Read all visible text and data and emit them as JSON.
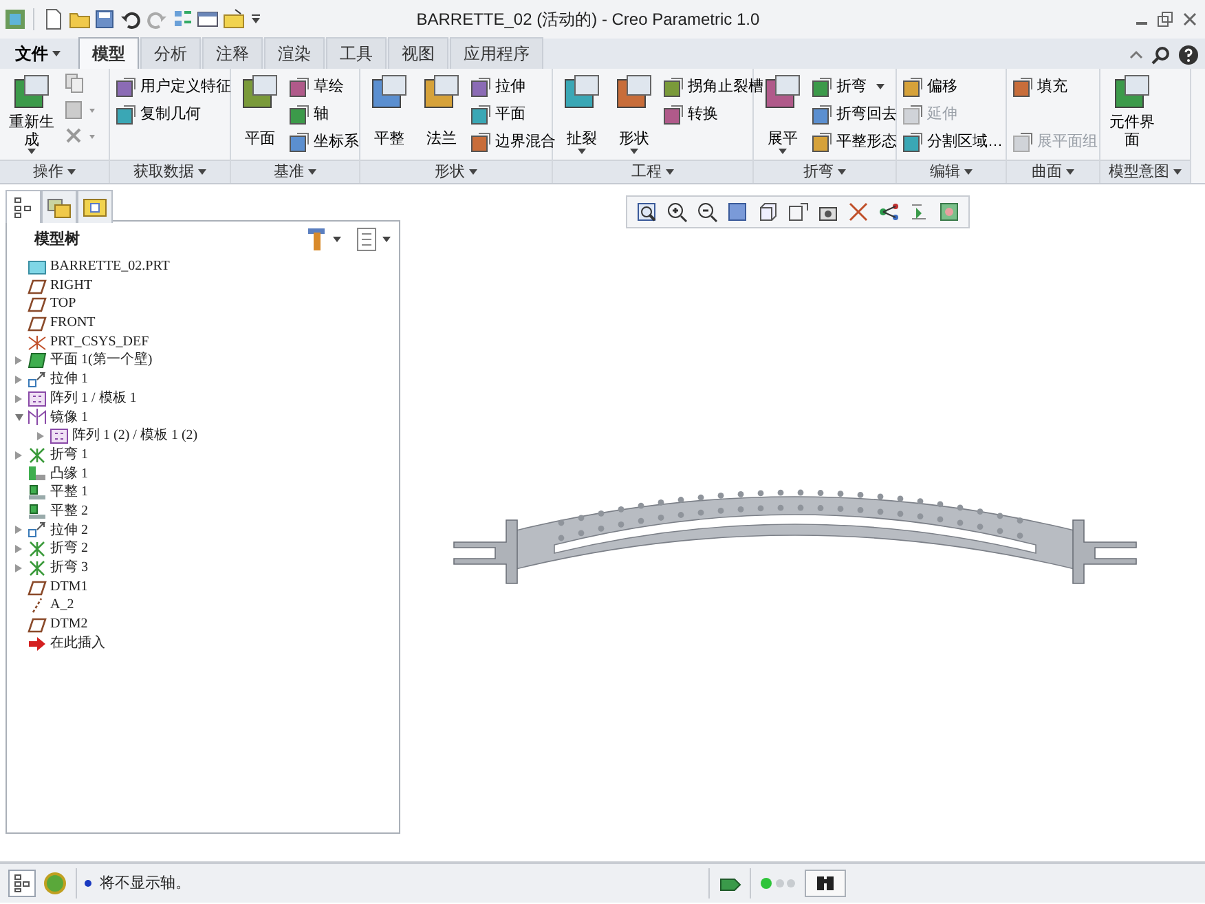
{
  "window": {
    "title": "BARRETTE_02 (活动的) - Creo Parametric 1.0"
  },
  "file_menu": {
    "label": "文件"
  },
  "tabs": [
    {
      "label": "模型",
      "selected": true
    },
    {
      "label": "分析",
      "selected": false
    },
    {
      "label": "注释",
      "selected": false
    },
    {
      "label": "渲染",
      "selected": false
    },
    {
      "label": "工具",
      "selected": false
    },
    {
      "label": "视图",
      "selected": false
    },
    {
      "label": "应用程序",
      "selected": false
    }
  ],
  "ribbon_groups": [
    {
      "label": "操作",
      "items": [
        {
          "kind": "large",
          "label": "重新生成",
          "dropdown": true
        },
        {
          "kind": "icon_stack"
        }
      ]
    },
    {
      "label": "获取数据",
      "items": [
        {
          "kind": "small",
          "label": "用户定义特征"
        },
        {
          "kind": "small",
          "label": "复制几何"
        }
      ]
    },
    {
      "label": "基准",
      "items": [
        {
          "kind": "large",
          "label": "平面"
        },
        {
          "kind": "small",
          "label": "草绘"
        },
        {
          "kind": "small",
          "label": "轴"
        },
        {
          "kind": "small",
          "label": "坐标系"
        }
      ]
    },
    {
      "label": "形状",
      "items": [
        {
          "kind": "large",
          "label": "平整"
        },
        {
          "kind": "large",
          "label": "法兰"
        },
        {
          "kind": "small",
          "label": "拉伸"
        },
        {
          "kind": "small",
          "label": "平面"
        },
        {
          "kind": "small",
          "label": "边界混合"
        }
      ]
    },
    {
      "label": "工程",
      "items": [
        {
          "kind": "large",
          "label": "扯裂",
          "dropdown": true
        },
        {
          "kind": "large",
          "label": "形状",
          "dropdown": true
        },
        {
          "kind": "small",
          "label": "拐角止裂槽"
        },
        {
          "kind": "small",
          "label": "转换"
        }
      ]
    },
    {
      "label": "折弯",
      "items": [
        {
          "kind": "large",
          "label": "展平",
          "dropdown": true
        },
        {
          "kind": "small",
          "label": "折弯",
          "dropdown": true
        },
        {
          "kind": "small",
          "label": "折弯回去"
        },
        {
          "kind": "small",
          "label": "平整形态"
        }
      ]
    },
    {
      "label": "编辑",
      "items": [
        {
          "kind": "small",
          "label": "偏移",
          "disabled": false
        },
        {
          "kind": "small",
          "label": "延伸",
          "disabled": true
        },
        {
          "kind": "small",
          "label": "分割区域…",
          "disabled": false
        }
      ]
    },
    {
      "label": "曲面",
      "items": [
        {
          "kind": "small",
          "label": "填充",
          "disabled": false
        },
        {
          "kind": "spacer"
        },
        {
          "kind": "small",
          "label": "展平面组",
          "disabled": true
        }
      ]
    },
    {
      "label": "模型意图",
      "items": [
        {
          "kind": "large",
          "label": "元件界面"
        }
      ]
    }
  ],
  "model_tree": {
    "title": "模型树",
    "items": [
      {
        "kind": "part",
        "label": "BARRETTE_02.PRT"
      },
      {
        "kind": "datum_plane",
        "label": "RIGHT"
      },
      {
        "kind": "datum_plane",
        "label": "TOP"
      },
      {
        "kind": "datum_plane",
        "label": "FRONT"
      },
      {
        "kind": "csys",
        "label": "PRT_CSYS_DEF"
      },
      {
        "kind": "wall",
        "label": "平面 1(第一个壁)",
        "expanded": false
      },
      {
        "kind": "extrude",
        "label": "拉伸 1",
        "expanded": false
      },
      {
        "kind": "pattern",
        "label": "阵列 1 / 模板 1",
        "expanded": false
      },
      {
        "kind": "mirror",
        "label": "镜像 1",
        "expanded": true,
        "children": [
          {
            "kind": "pattern",
            "label": "阵列 1 (2) / 模板 1 (2)",
            "expanded": false
          }
        ]
      },
      {
        "kind": "bend",
        "label": "折弯 1",
        "expanded": false
      },
      {
        "kind": "flange",
        "label": "凸缘 1"
      },
      {
        "kind": "flat",
        "label": "平整 1"
      },
      {
        "kind": "flat",
        "label": "平整 2"
      },
      {
        "kind": "extrude",
        "label": "拉伸 2",
        "expanded": false
      },
      {
        "kind": "bend",
        "label": "折弯 2",
        "expanded": false
      },
      {
        "kind": "bend",
        "label": "折弯 3",
        "expanded": false
      },
      {
        "kind": "datum_plane",
        "label": "DTM1"
      },
      {
        "kind": "axis",
        "label": "A_2"
      },
      {
        "kind": "datum_plane",
        "label": "DTM2"
      },
      {
        "kind": "insert",
        "label": "在此插入"
      }
    ]
  },
  "status_bar": {
    "message": "将不显示轴。"
  }
}
